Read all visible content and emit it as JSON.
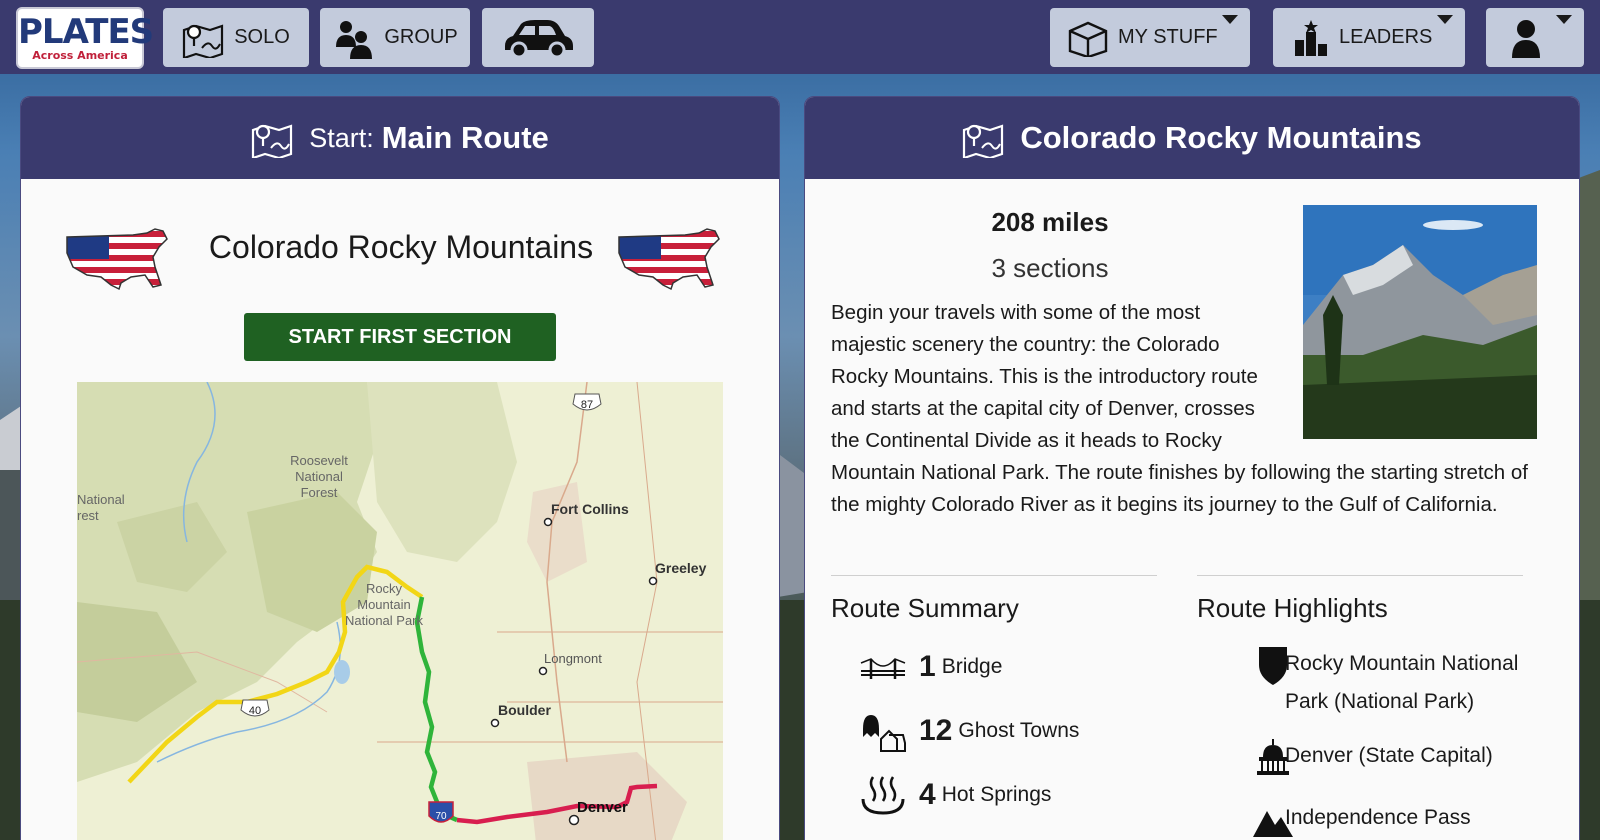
{
  "nav": {
    "logo_main": "PLATES",
    "logo_sub": "Across America",
    "solo_label": "SOLO",
    "group_label": "GROUP",
    "my_stuff_label": "MY STUFF",
    "leaders_label": "LEADERS"
  },
  "left_panel": {
    "header_prefix": "Start:",
    "header_title": "Main Route",
    "route_title": "Colorado Rocky Mountains",
    "start_button": "START FIRST SECTION",
    "map": {
      "labels": {
        "forest": [
          "Roosevelt",
          "National",
          "Forest"
        ],
        "forest2": [
          "National",
          "rest"
        ],
        "fort_collins": "Fort Collins",
        "greeley": "Greeley",
        "rmnp": [
          "Rocky",
          "Mountain",
          "National Park"
        ],
        "longmont": "Longmont",
        "boulder": "Boulder",
        "denver": "Denver",
        "us87": "87",
        "us40": "40",
        "i70": "70"
      }
    }
  },
  "right_panel": {
    "header_title": "Colorado Rocky Mountains",
    "miles": "208 miles",
    "sections": "3 sections",
    "description": "Begin your travels with some of the most majestic scenery the country: the Colorado Rocky Mountains. This is the introductory route and starts at the capital city of Denver, crosses the Continental Divide as it heads to Rocky Mountain National Park. The route finishes by following the starting stretch of the mighty Colorado River as it begins its journey to the Gulf of California.",
    "summary_heading": "Route Summary",
    "summary": [
      {
        "icon": "bridge-icon",
        "count": "1",
        "label": "Bridge"
      },
      {
        "icon": "ghost-town-icon",
        "count": "12",
        "label": "Ghost Towns"
      },
      {
        "icon": "hot-springs-icon",
        "count": "4",
        "label": "Hot Springs"
      }
    ],
    "highlights_heading": "Route Highlights",
    "highlights": [
      {
        "icon": "national-park-icon",
        "label": "Rocky Mountain National Park (National Park)"
      },
      {
        "icon": "capitol-icon",
        "label": "Denver (State Capital)"
      },
      {
        "icon": "mountain-pass-icon",
        "label": "Independence Pass"
      }
    ]
  },
  "colors": {
    "nav_bg": "#3a3a6e",
    "nav_button_bg": "#c3cbdc",
    "start_button_bg": "#1f6122",
    "route_yellow": "#f2d616",
    "route_green": "#2fb43a",
    "route_red": "#d81e4f"
  }
}
